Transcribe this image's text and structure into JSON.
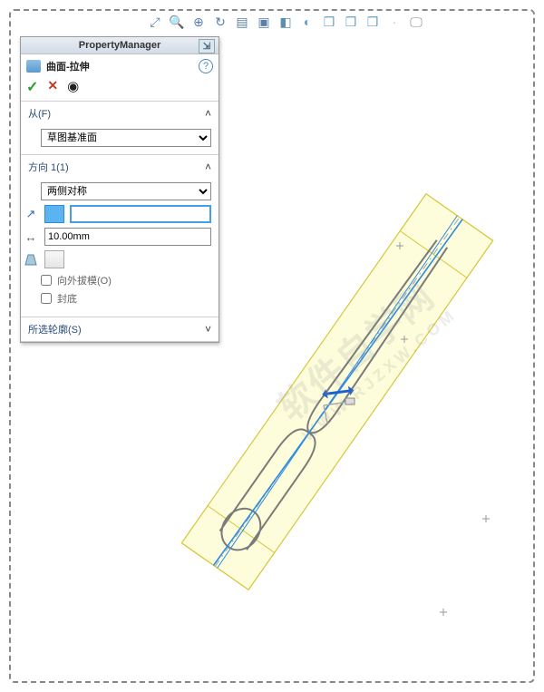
{
  "toolbar_icons": [
    "origin",
    "zoom-area",
    "magnify",
    "rotate",
    "section",
    "appearance",
    "display",
    "render",
    "cube1",
    "cube2",
    "cube3",
    "sep",
    "monitor"
  ],
  "panel": {
    "title": "PropertyManager",
    "feature_label": "曲面-拉伸",
    "sections": {
      "from": {
        "label": "从(F)",
        "value": "草图基准面"
      },
      "dir1": {
        "label": "方向 1(1)",
        "method": "两侧对称",
        "blind_value": "",
        "distance": "10.00mm",
        "draft_outward": "向外拔模(O)",
        "cap_end": "封底",
        "draft_outward_checked": false,
        "cap_end_checked": false
      },
      "contours": {
        "label": "所选轮廓(S)"
      }
    }
  },
  "watermark": {
    "main": "软件自学网",
    "sub": "WWW.RJZXW.COM"
  }
}
